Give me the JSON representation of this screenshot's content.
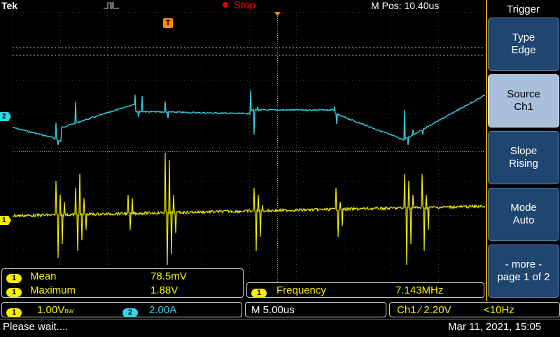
{
  "top": {
    "brand": "Tek",
    "run_state": "Stop",
    "m_pos": "M Pos: 10.40us"
  },
  "trigger_menu": {
    "title": "Trigger",
    "buttons": [
      {
        "line1": "Type",
        "line2": "Edge"
      },
      {
        "line1": "Source",
        "line2": "Ch1"
      },
      {
        "line1": "Slope",
        "line2": "Rising"
      },
      {
        "line1": "Mode",
        "line2": "Auto"
      },
      {
        "line1": "- more -",
        "line2": "page 1 of 2"
      }
    ]
  },
  "markers": {
    "ch2": "2",
    "ch1": "1",
    "trigger": "T"
  },
  "measurements": {
    "mean_label": "Mean",
    "mean_value": "78.5mV",
    "max_label": "Maximum",
    "max_value": "1.88V",
    "freq_label": "Frequency",
    "freq_value": "7.143MHz"
  },
  "channel_bar": {
    "ch1_badge": "1",
    "ch1_scale": "1.00V",
    "ch1_bw": "BW",
    "ch2_badge": "2",
    "ch2_scale": "2.00A",
    "timebase": "M 5.00us",
    "trigger_info": "Ch1 ⁄ 2.20V",
    "trigger_freq": "<10Hz"
  },
  "status": {
    "message": "Please wait....",
    "datetime": "Mar 11, 2021, 15:05"
  },
  "colors": {
    "ch1": "#f4f000",
    "ch2": "#35d4e5",
    "menu_button": "#1f466f",
    "menu_selected": "#a9bfdc",
    "stop": "#e00000",
    "trigger_marker": "#ff8c00"
  }
}
